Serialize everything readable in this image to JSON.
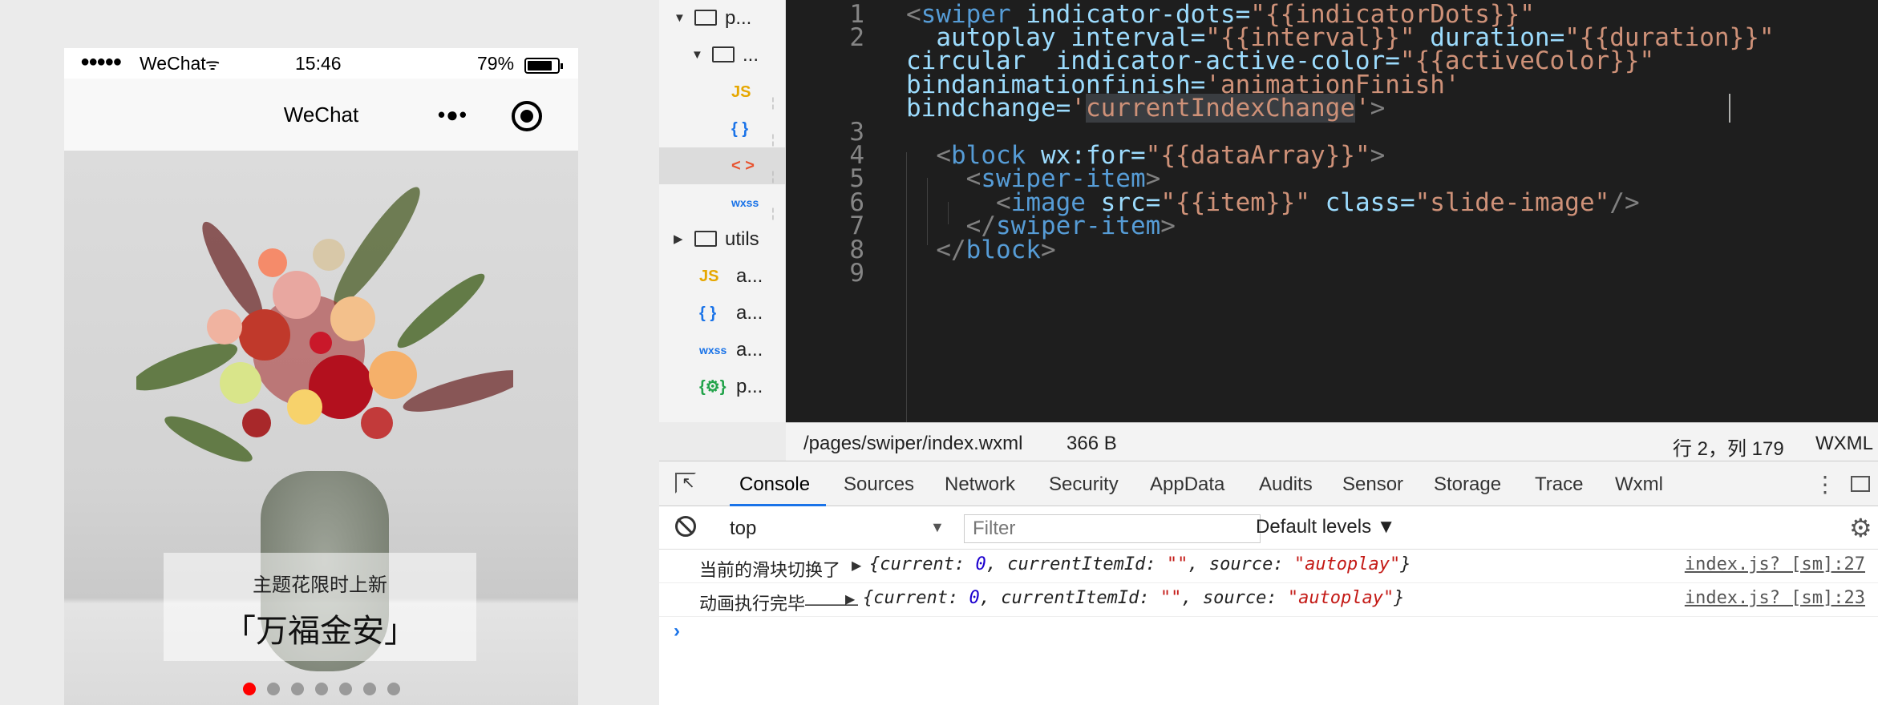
{
  "phone": {
    "status": {
      "signal": "●●●●●",
      "carrier": "WeChat",
      "time": "15:46",
      "battery": "79%"
    },
    "navbar": {
      "title": "WeChat"
    },
    "swiper": {
      "caption_sub": "主题花限时上新",
      "caption_main": "「万福金安」",
      "dot_count": 7,
      "active_index": 0,
      "active_color": "#ff0000",
      "inactive_color": "#9a9a9a"
    }
  },
  "file_tree": {
    "items": [
      {
        "type": "folder-open",
        "label": "p..."
      },
      {
        "type": "folder-open",
        "label": "..."
      },
      {
        "type": "js",
        "icon": "JS",
        "color": "#e6a700"
      },
      {
        "type": "json",
        "icon": "{ }",
        "color": "#1a73e8"
      },
      {
        "type": "wxml",
        "icon": "< >",
        "color": "#e8532f"
      },
      {
        "type": "wxss",
        "icon": "wxss",
        "color": "#1a73e8"
      },
      {
        "type": "folder-closed",
        "label": "utils"
      },
      {
        "type": "js",
        "icon": "JS",
        "label": "a...",
        "color": "#e6a700"
      },
      {
        "type": "json",
        "icon": "{ }",
        "label": "a...",
        "color": "#1a73e8"
      },
      {
        "type": "wxss",
        "icon": "wxss",
        "label": "a...",
        "color": "#1a73e8"
      },
      {
        "type": "config",
        "icon": "{⚙}",
        "label": "p...",
        "color": "#22a34a"
      }
    ]
  },
  "editor": {
    "line_numbers": [
      "1",
      "2",
      "3",
      "4",
      "5",
      "6",
      "7",
      "8",
      "9"
    ],
    "status": {
      "path": "/pages/swiper/index.wxml",
      "size": "366 B",
      "position": "行 2，列 179",
      "language": "WXML"
    }
  },
  "devtools": {
    "tabs": [
      "Console",
      "Sources",
      "Network",
      "Security",
      "AppData",
      "Audits",
      "Sensor",
      "Storage",
      "Trace",
      "Wxml"
    ],
    "active_tab": "Console",
    "context": "top",
    "filter_placeholder": "Filter",
    "levels": "Default levels ▼",
    "logs": [
      {
        "message": "当前的滑块切换了",
        "current": "0",
        "currentItemId": "\"\"",
        "source": "\"autoplay\"",
        "src": "index.js? [sm]:27"
      },
      {
        "message": "动画执行完毕———",
        "current": "0",
        "currentItemId": "\"\"",
        "source": "\"autoplay\"",
        "src": "index.js? [sm]:23"
      }
    ]
  }
}
